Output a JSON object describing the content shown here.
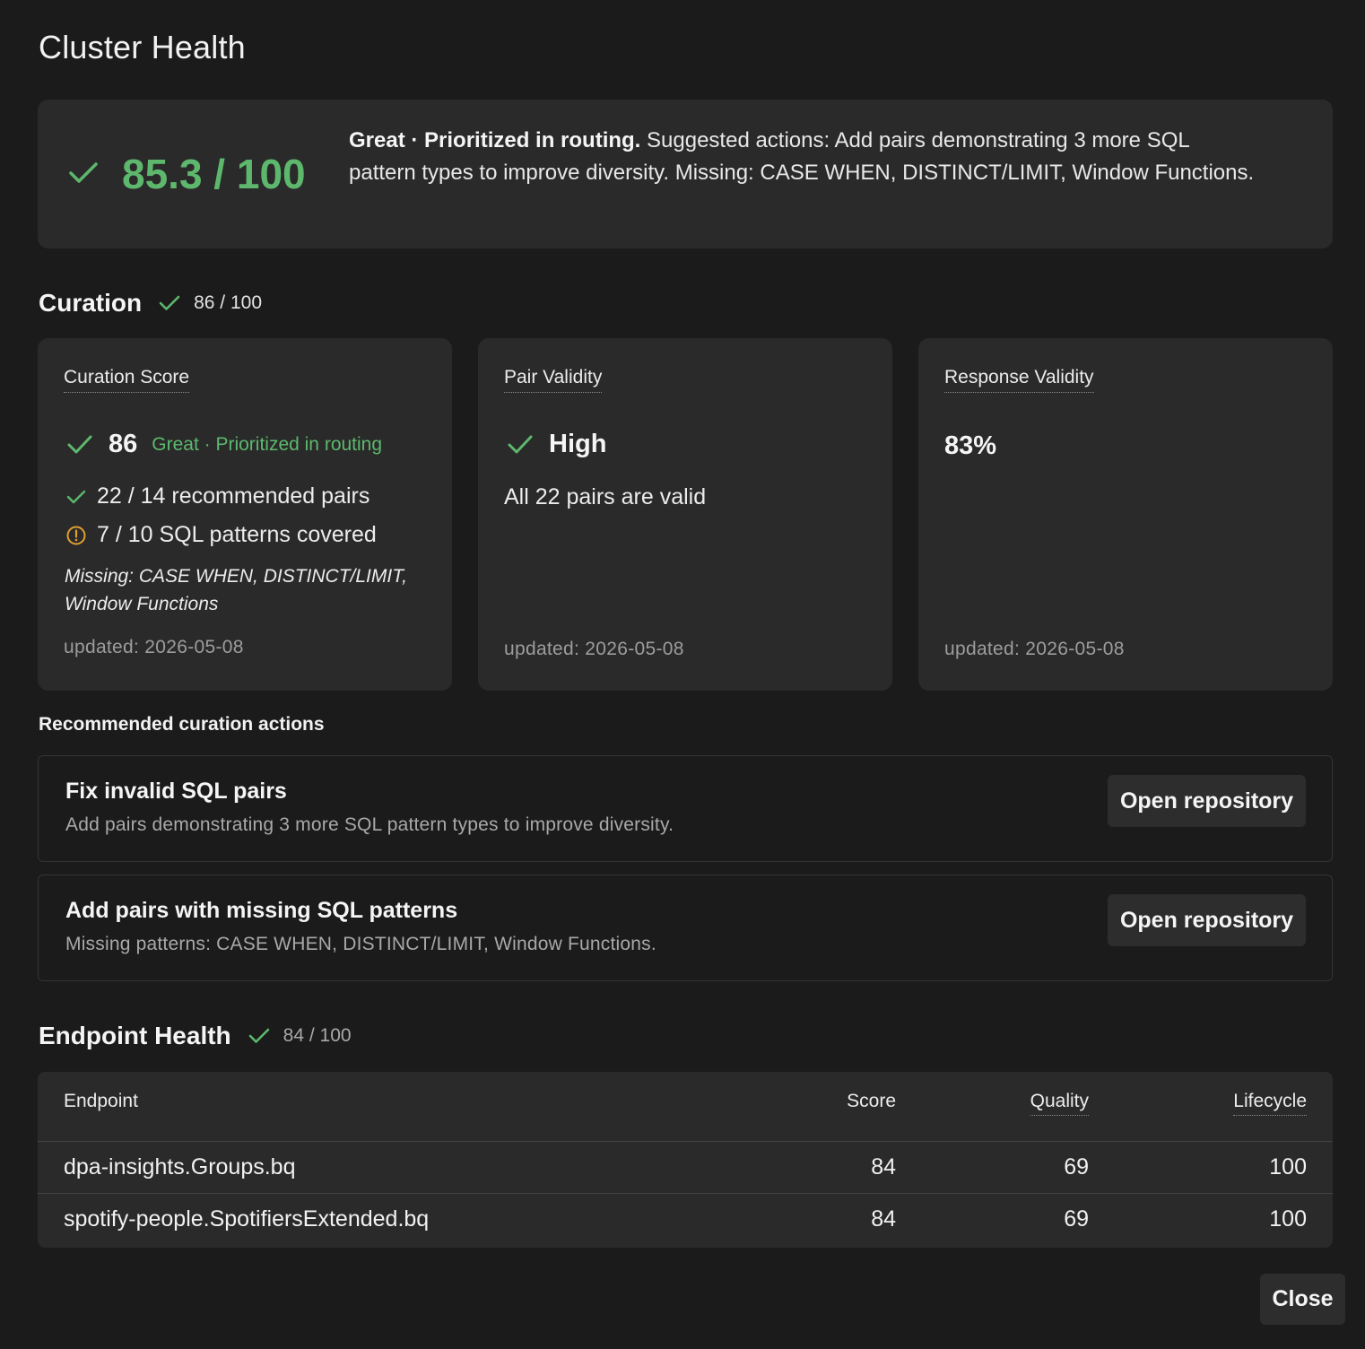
{
  "dialog": {
    "title": "Cluster Health",
    "close_label": "Close"
  },
  "summary": {
    "score": "85.3 / 100",
    "lead": "Great · Prioritized in routing.",
    "message": " Suggested actions: Add pairs demonstrating 3 more SQL pattern types to improve diversity. Missing: CASE WHEN, DISTINCT/LIMIT, Window Functions.",
    "accent_color": "#5db86d"
  },
  "curation": {
    "heading": "Curation",
    "score": "86 / 100",
    "cards": {
      "curation_score": {
        "label": "Curation Score",
        "value": "86",
        "status": "Great · Prioritized in routing",
        "pairs": "22 / 14 recommended pairs",
        "patterns": "7 / 10 SQL patterns covered",
        "missing": "Missing: CASE WHEN, DISTINCT/LIMIT, Window Functions",
        "updated": "updated: 2026-05-08"
      },
      "pair_validity": {
        "label": "Pair Validity",
        "value": "High",
        "detail": "All 22 pairs are valid",
        "updated": "updated: 2026-05-08"
      },
      "response_validity": {
        "label": "Response Validity",
        "value": "83%",
        "updated": "updated: 2026-05-08"
      }
    }
  },
  "recommended": {
    "heading": "Recommended curation actions",
    "actions": [
      {
        "title": "Fix invalid SQL pairs",
        "description": "Add pairs demonstrating 3 more SQL pattern types to improve diversity.",
        "button": "Open repository"
      },
      {
        "title": "Add pairs with missing SQL patterns",
        "description": "Missing patterns: CASE WHEN, DISTINCT/LIMIT, Window Functions.",
        "button": "Open repository"
      }
    ]
  },
  "endpoint_health": {
    "heading": "Endpoint Health",
    "score": "84 / 100",
    "columns": [
      "Endpoint",
      "Score",
      "Quality",
      "Lifecycle"
    ],
    "rows": [
      {
        "endpoint": "dpa-insights.Groups.bq",
        "score": "84",
        "quality": "69",
        "lifecycle": "100"
      },
      {
        "endpoint": "spotify-people.SpotifiersExtended.bq",
        "score": "84",
        "quality": "69",
        "lifecycle": "100"
      }
    ]
  },
  "icons": {
    "check": "check-icon",
    "warning": "warning-circle-icon",
    "warning_color": "#e0a030"
  }
}
